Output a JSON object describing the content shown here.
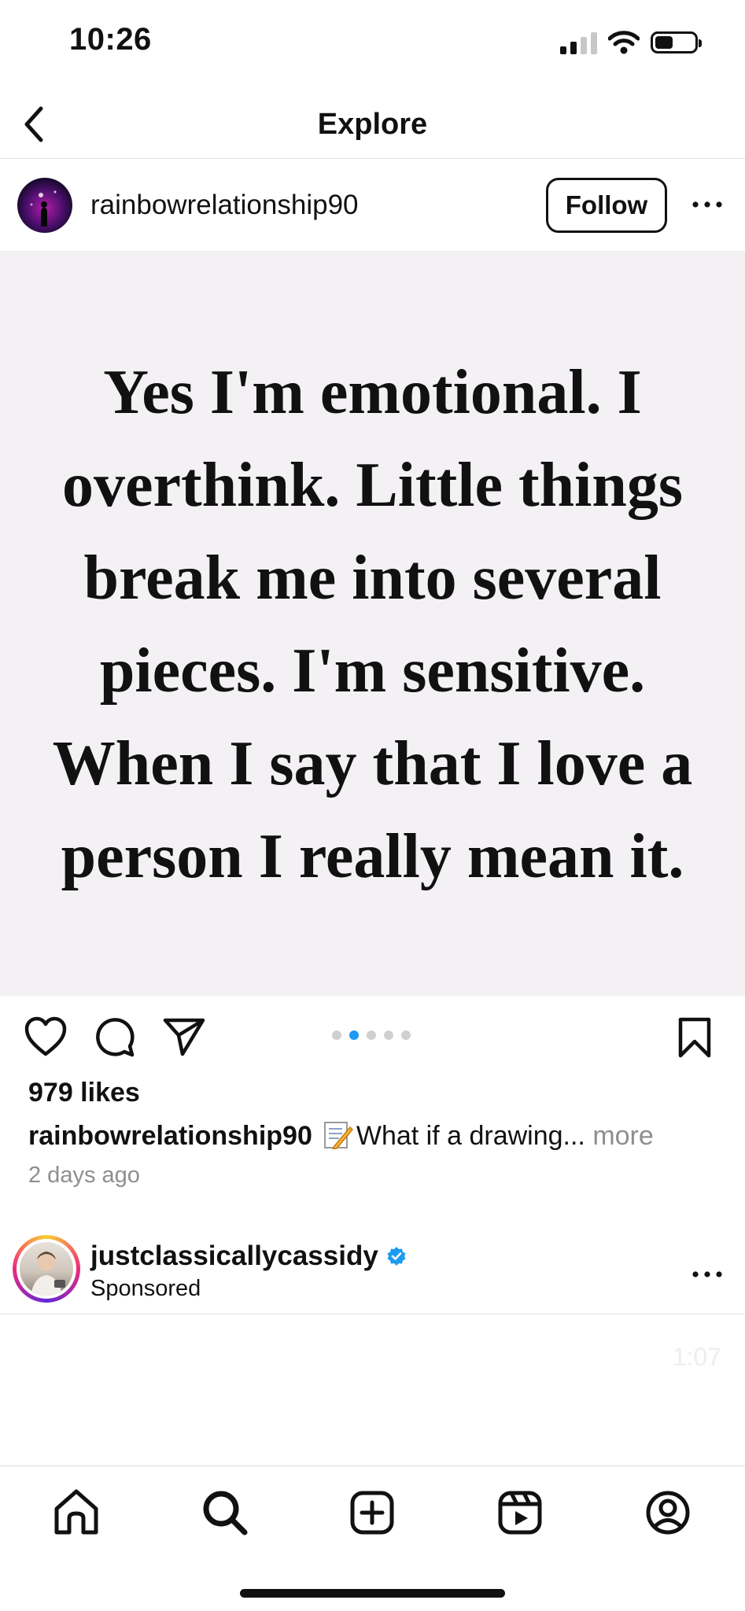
{
  "status_bar": {
    "time": "10:26"
  },
  "header": {
    "title": "Explore"
  },
  "post": {
    "username": "rainbowrelationship90",
    "follow_label": "Follow",
    "quote_lines": [
      "Yes I'm emotional. I",
      "overthink. Little things",
      "break me into several",
      "pieces. I'm sensitive.",
      "When I say that I love a",
      "person I really mean it."
    ],
    "carousel": {
      "count": 5,
      "active_index": 1
    },
    "likes": "979 likes",
    "caption_user": "rainbowrelationship90",
    "caption_text": "What if a drawing...",
    "caption_more": "more",
    "time_ago": "2 days ago"
  },
  "sponsored_post": {
    "username": "justclassicallycassidy",
    "label": "Sponsored",
    "video_time": "1:07"
  },
  "colors": {
    "accent_blue": "#1d9bf0",
    "muted_text": "#8e8e8e"
  },
  "tabbar": {
    "items": [
      "home-icon",
      "search-icon",
      "create-icon",
      "reels-icon",
      "profile-icon"
    ]
  }
}
